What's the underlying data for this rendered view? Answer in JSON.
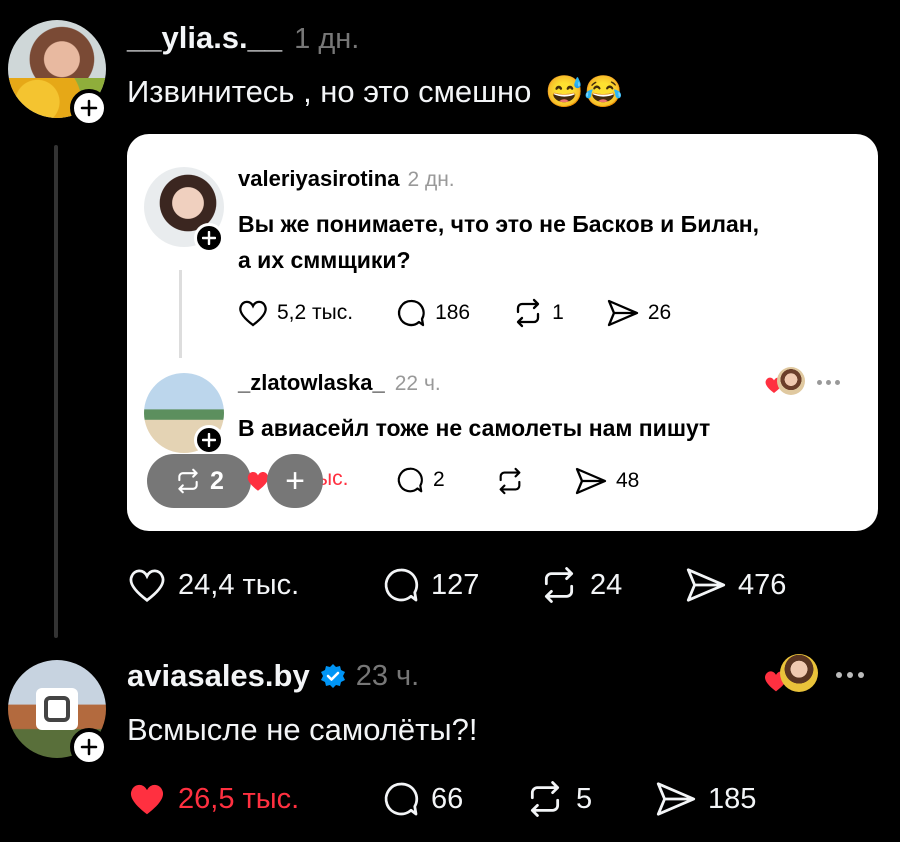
{
  "post1": {
    "username": "__ylia.s.__",
    "time": "1 дн.",
    "text": "Извинитесь , но это смешно",
    "emojis": "😅😂",
    "likes": "24,4 тыс.",
    "comments": "127",
    "reposts": "24",
    "shares": "476"
  },
  "quoted": {
    "post": {
      "username": "valeriyasirotina",
      "time": "2 дн.",
      "text_line1": "Вы же понимаете, что это не Басков и Билан,",
      "text_line2": "а их сммщики?",
      "likes": "5,2 тыс.",
      "comments": "186",
      "reposts": "1",
      "shares": "26"
    },
    "reply": {
      "username": "_zlatowlaska_",
      "time": "22 ч.",
      "text": "В авиасейл тоже не самолеты нам пишут",
      "likes_partial": "ыс.",
      "comments": "2",
      "shares": "48"
    },
    "overlay": {
      "repost_count": "2",
      "plus": "+"
    }
  },
  "post2": {
    "username": "aviasales.by",
    "time": "23 ч.",
    "text": "Всмысле не самолёты?!",
    "likes": "26,5 тыс.",
    "comments": "66",
    "reposts": "5",
    "shares": "185"
  },
  "colors": {
    "background": "#000000",
    "text": "#f3f5f7",
    "muted": "#777777",
    "liked": "#ff3040",
    "verified": "#0095f6"
  }
}
